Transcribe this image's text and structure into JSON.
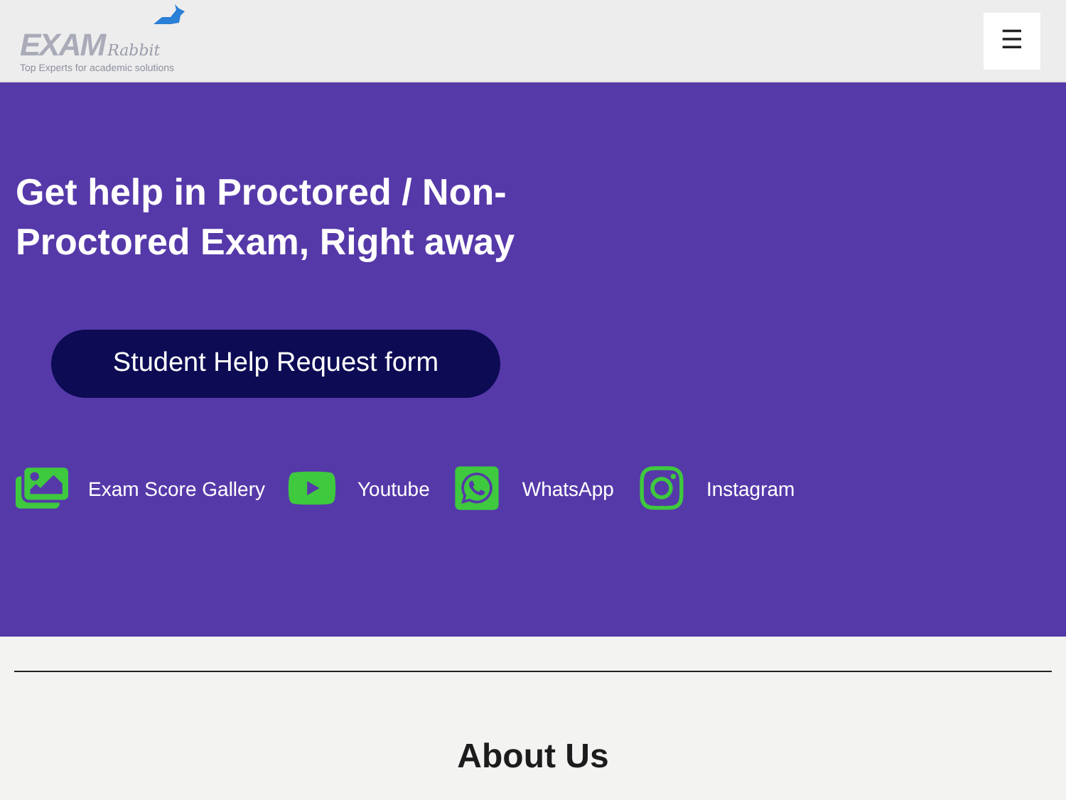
{
  "header": {
    "logo": {
      "word": "EXAM",
      "script": "Rabbit",
      "tagline": "Top Experts for academic solutions"
    },
    "menu_button": "☰"
  },
  "hero": {
    "heading": "Get help in Proctored / Non-Proctored Exam, Right away",
    "button": "Student Help Request form",
    "links": [
      {
        "kind": "gallery",
        "label": "Exam Score Gallery"
      },
      {
        "kind": "youtube",
        "label": "Youtube"
      },
      {
        "kind": "whatsapp",
        "label": "WhatsApp"
      },
      {
        "kind": "instagram",
        "label": "Instagram"
      }
    ]
  },
  "about": {
    "heading": "About Us"
  }
}
